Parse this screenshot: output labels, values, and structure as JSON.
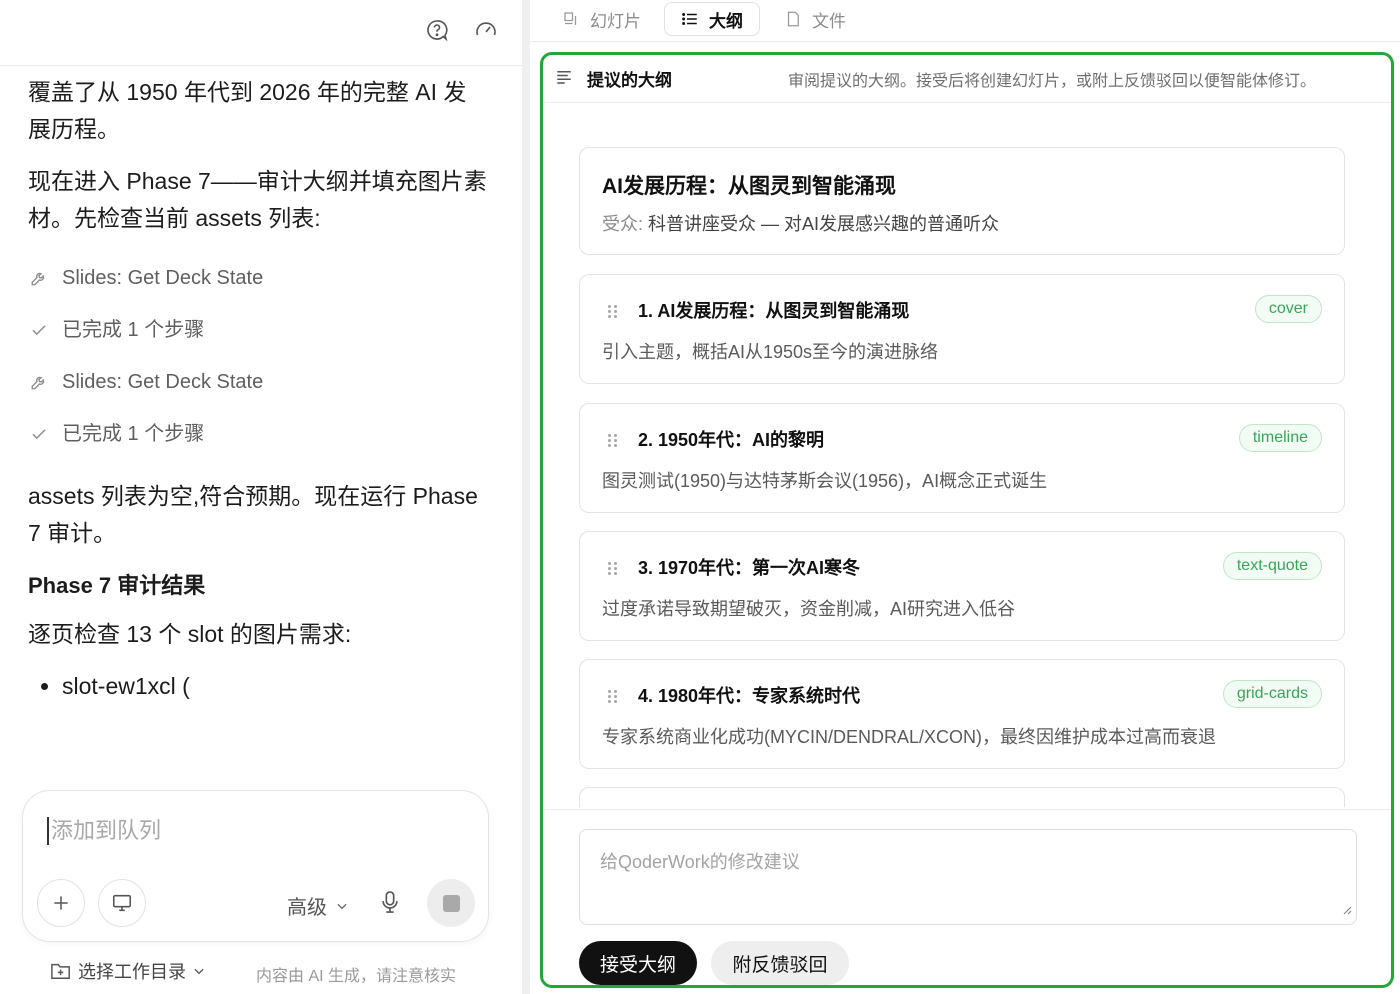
{
  "chat": {
    "messages": [
      "覆盖了从 1950 年代到 2026 年的完整 AI 发展历程。",
      "现在进入 Phase 7——审计大纲并填充图片素材。先检查当前 assets 列表:"
    ],
    "tools": [
      {
        "icon": "wrench-icon",
        "label": "Slides: Get Deck State"
      },
      {
        "icon": "check-icon",
        "label": "已完成 1 个步骤"
      },
      {
        "icon": "wrench-icon",
        "label": "Slides: Get Deck State"
      },
      {
        "icon": "check-icon",
        "label": "已完成 1 个步骤"
      }
    ],
    "after_tools": "assets 列表为空,符合预期。现在运行 Phase 7 审计。",
    "heading": "Phase 7 审计结果",
    "intro": "逐页检查 13 个 slot 的图片需求:",
    "bullet": "slot-ew1xcl ("
  },
  "composer": {
    "placeholder": "添加到队列",
    "advanced_label": "高级"
  },
  "footer": {
    "workdir_label": "选择工作目录",
    "note": "内容由 AI 生成，请注意核实"
  },
  "tabs": [
    {
      "label": "幻灯片",
      "icon": "slides-icon",
      "active": false
    },
    {
      "label": "大纲",
      "icon": "list-icon",
      "active": true
    },
    {
      "label": "文件",
      "icon": "file-icon",
      "active": false
    }
  ],
  "outline": {
    "title": "提议的大纲",
    "description": "审阅提议的大纲。接受后将创建幻灯片，或附上反馈驳回以便智能体修订。",
    "deck_title": "AI发展历程：从图灵到智能涌现",
    "audience_label": "受众:",
    "audience": "科普讲座受众 — 对AI发展感兴趣的普通听众",
    "slides": [
      {
        "title": "1. AI发展历程：从图灵到智能涌现",
        "desc": "引入主题，概括AI从1950s至今的演进脉络",
        "layout": "cover"
      },
      {
        "title": "2. 1950年代：AI的黎明",
        "desc": "图灵测试(1950)与达特茅斯会议(1956)，AI概念正式诞生",
        "layout": "timeline"
      },
      {
        "title": "3. 1970年代：第一次AI寒冬",
        "desc": "过度承诺导致期望破灭，资金削减，AI研究进入低谷",
        "layout": "text-quote"
      },
      {
        "title": "4. 1980年代：专家系统时代",
        "desc": "专家系统商业化成功(MYCIN/DENDRAL/XCON)，最终因维护成本过高而衰退",
        "layout": "grid-cards"
      }
    ],
    "feedback_placeholder": "给QoderWork的修改建议",
    "accept_label": "接受大纲",
    "reject_label": "附反馈驳回"
  },
  "colors": {
    "accent_green": "#22a83a",
    "badge_text": "#3aa55a"
  }
}
